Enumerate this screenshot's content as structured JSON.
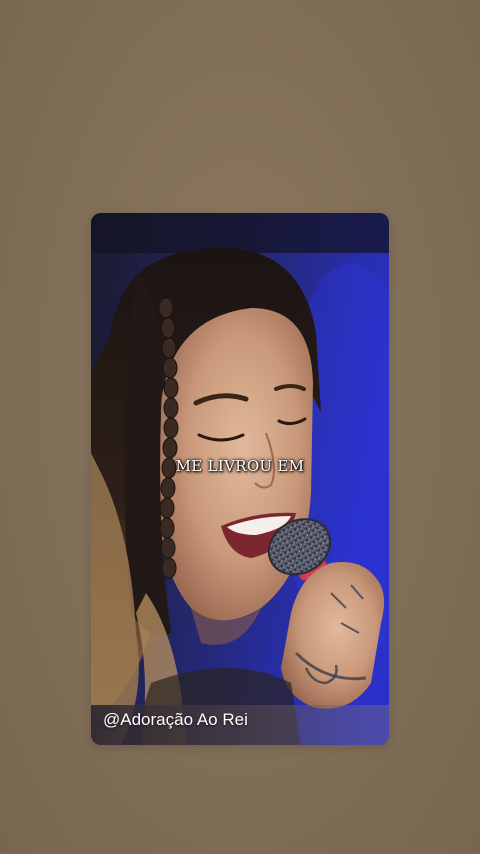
{
  "screen": {
    "background_color": "#83705a"
  },
  "video": {
    "caption": "ME LIVROU EM",
    "watermark": "@Adoração Ao Rei",
    "stage_light_color": "#2a31c8"
  }
}
